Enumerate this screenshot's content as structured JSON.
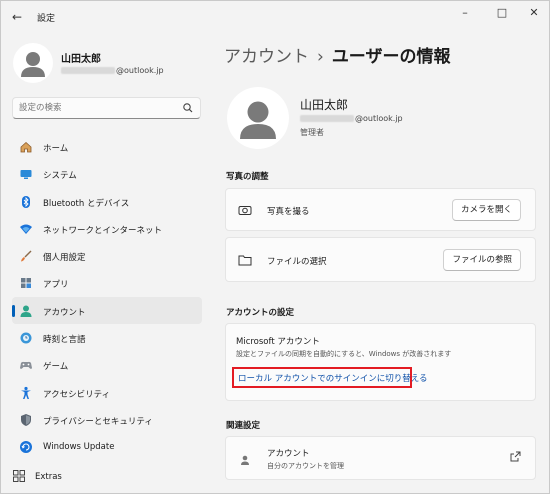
{
  "window": {
    "title": "設定",
    "back_icon": "arrow-left-icon",
    "controls": [
      "minimize-icon",
      "maximize-icon",
      "close-icon"
    ]
  },
  "profile": {
    "name": "山田太郎",
    "email_suffix": "@outlook.jp"
  },
  "search": {
    "placeholder": "設定の検索"
  },
  "sidebar": {
    "items": [
      {
        "label": "ホーム",
        "icon": "home-icon"
      },
      {
        "label": "システム",
        "icon": "monitor-icon"
      },
      {
        "label": "Bluetooth とデバイス",
        "icon": "bluetooth-icon"
      },
      {
        "label": "ネットワークとインターネット",
        "icon": "wifi-icon"
      },
      {
        "label": "個人用設定",
        "icon": "brush-icon"
      },
      {
        "label": "アプリ",
        "icon": "apps-icon"
      },
      {
        "label": "アカウント",
        "icon": "account-icon",
        "active": true
      },
      {
        "label": "時刻と言語",
        "icon": "globe-clock-icon"
      },
      {
        "label": "ゲーム",
        "icon": "gamepad-icon"
      },
      {
        "label": "アクセシビリティ",
        "icon": "accessibility-icon"
      },
      {
        "label": "プライバシーとセキュリティ",
        "icon": "shield-icon"
      },
      {
        "label": "Windows Update",
        "icon": "update-icon"
      }
    ],
    "extras_label": "Extras"
  },
  "header": {
    "breadcrumb_parent": "アカウント",
    "separator": "›",
    "breadcrumb_current": "ユーザーの情報"
  },
  "user": {
    "name": "山田太郎",
    "email_suffix": "@outlook.jp",
    "role": "管理者"
  },
  "photo_section": {
    "title": "写真の調整",
    "camera_label": "写真を撮る",
    "camera_button": "カメラを開く",
    "file_label": "ファイルの選択",
    "file_button": "ファイルの参照"
  },
  "account_settings": {
    "title": "アカウントの設定",
    "card_title": "Microsoft アカウント",
    "card_desc": "設定とファイルの同期を自動的にすると、Windows が改善されます",
    "link": "ローカル アカウントでのサインインに切り替える"
  },
  "related": {
    "title": "関連設定",
    "item_title": "アカウント",
    "item_sub": "自分のアカウントを管理"
  },
  "colors": {
    "accent": "#005fb8",
    "link": "#0d4fa8",
    "highlight_box": "#e31b23"
  }
}
